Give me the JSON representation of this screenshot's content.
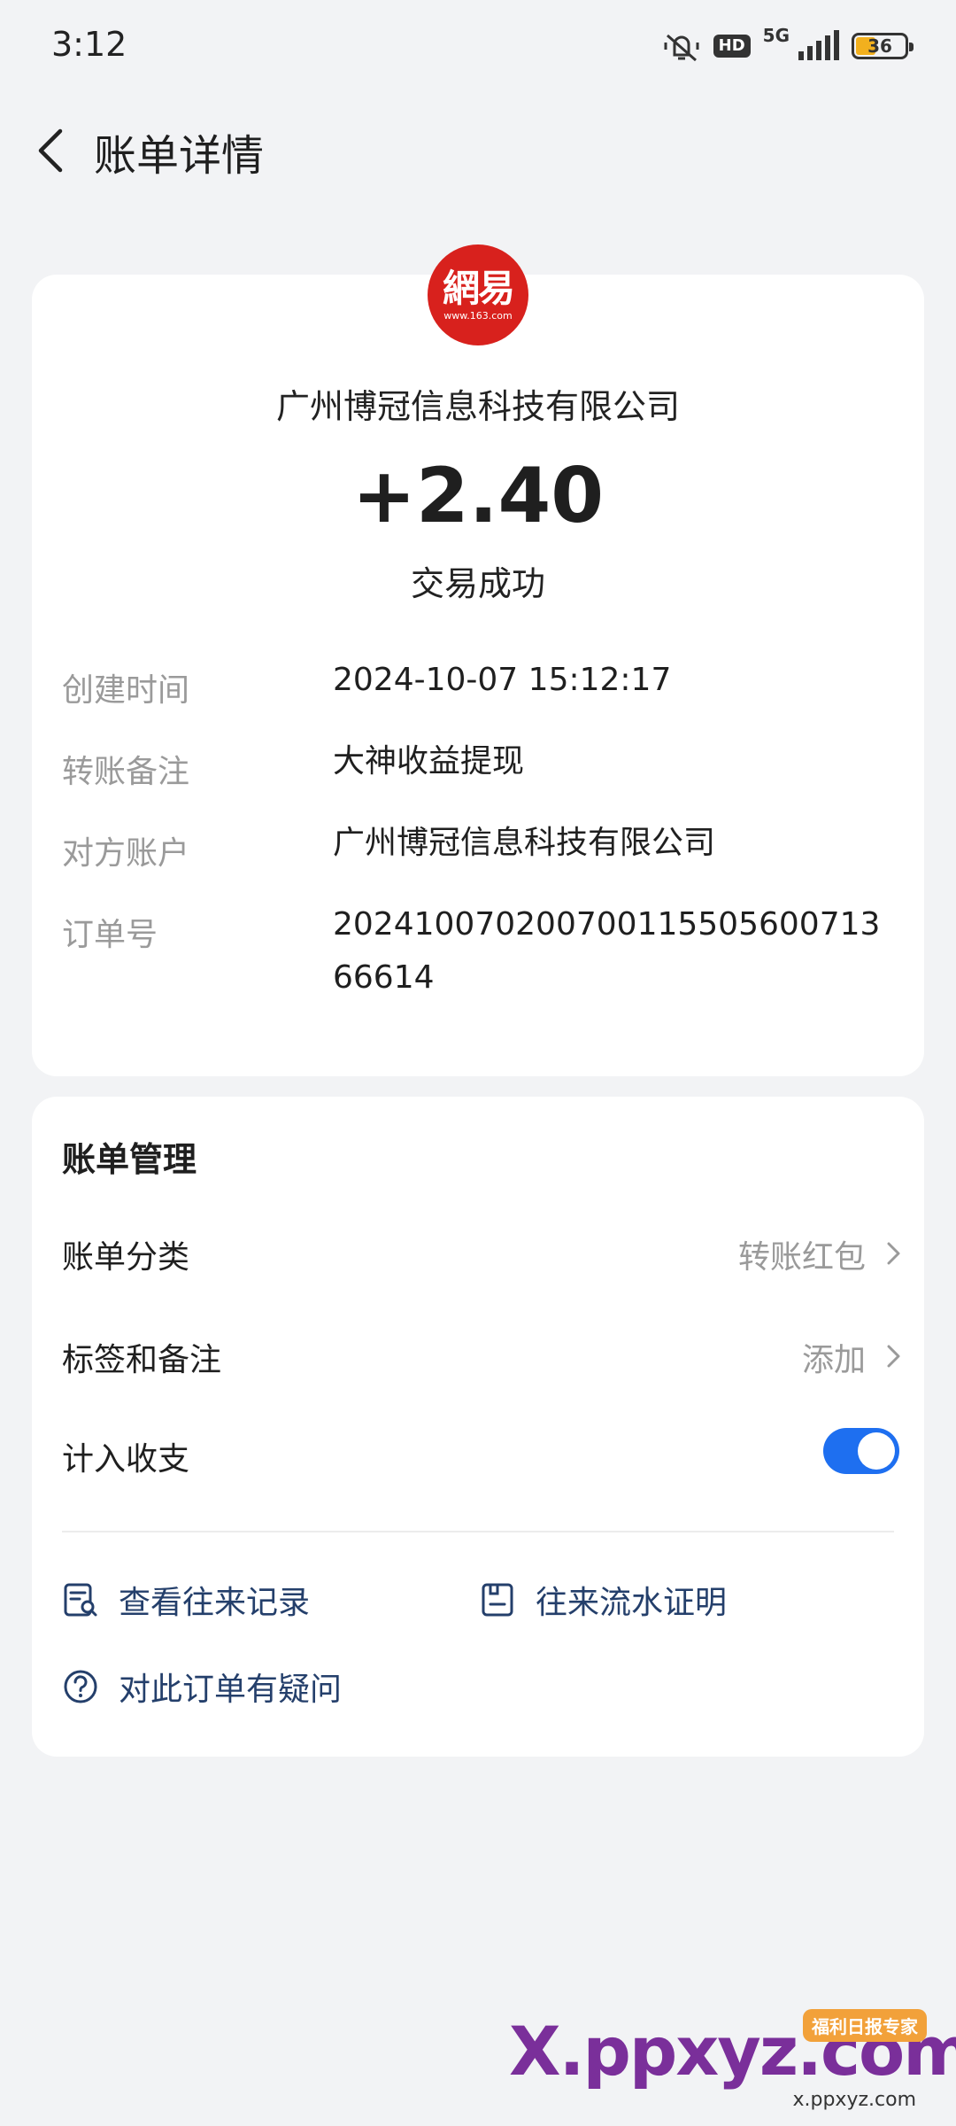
{
  "status_bar": {
    "time": "3:12",
    "hd_label": "HD",
    "network_label": "5G",
    "battery_level": "36"
  },
  "header": {
    "title": "账单详情"
  },
  "transaction": {
    "logo_text": "網易",
    "logo_subtext": "www.163.com",
    "merchant": "广州博冠信息科技有限公司",
    "amount": "+2.40",
    "status": "交易成功",
    "details": [
      {
        "label": "创建时间",
        "value": "2024-10-07 15:12:17"
      },
      {
        "label": "转账备注",
        "value": "大神收益提现"
      },
      {
        "label": "对方账户",
        "value": "广州博冠信息科技有限公司"
      },
      {
        "label": "订单号",
        "value": "20241007020070011550560071366614"
      }
    ]
  },
  "management": {
    "title": "账单管理",
    "category": {
      "label": "账单分类",
      "value": "转账红包"
    },
    "tags": {
      "label": "标签和备注",
      "value": "添加"
    },
    "include": {
      "label": "计入收支",
      "enabled": true
    },
    "links": {
      "records": "查看往来记录",
      "proof": "往来流水证明",
      "question": "对此订单有疑问"
    }
  },
  "watermark": {
    "main": "X.ppxyz.com",
    "badge": "福利日报专家",
    "sub": "x.ppxyz.com"
  },
  "colors": {
    "accent": "#1e6ff0",
    "link": "#243f6b",
    "logo": "#d8211d",
    "muted": "#9a9a9a",
    "background": "#f2f3f5"
  }
}
